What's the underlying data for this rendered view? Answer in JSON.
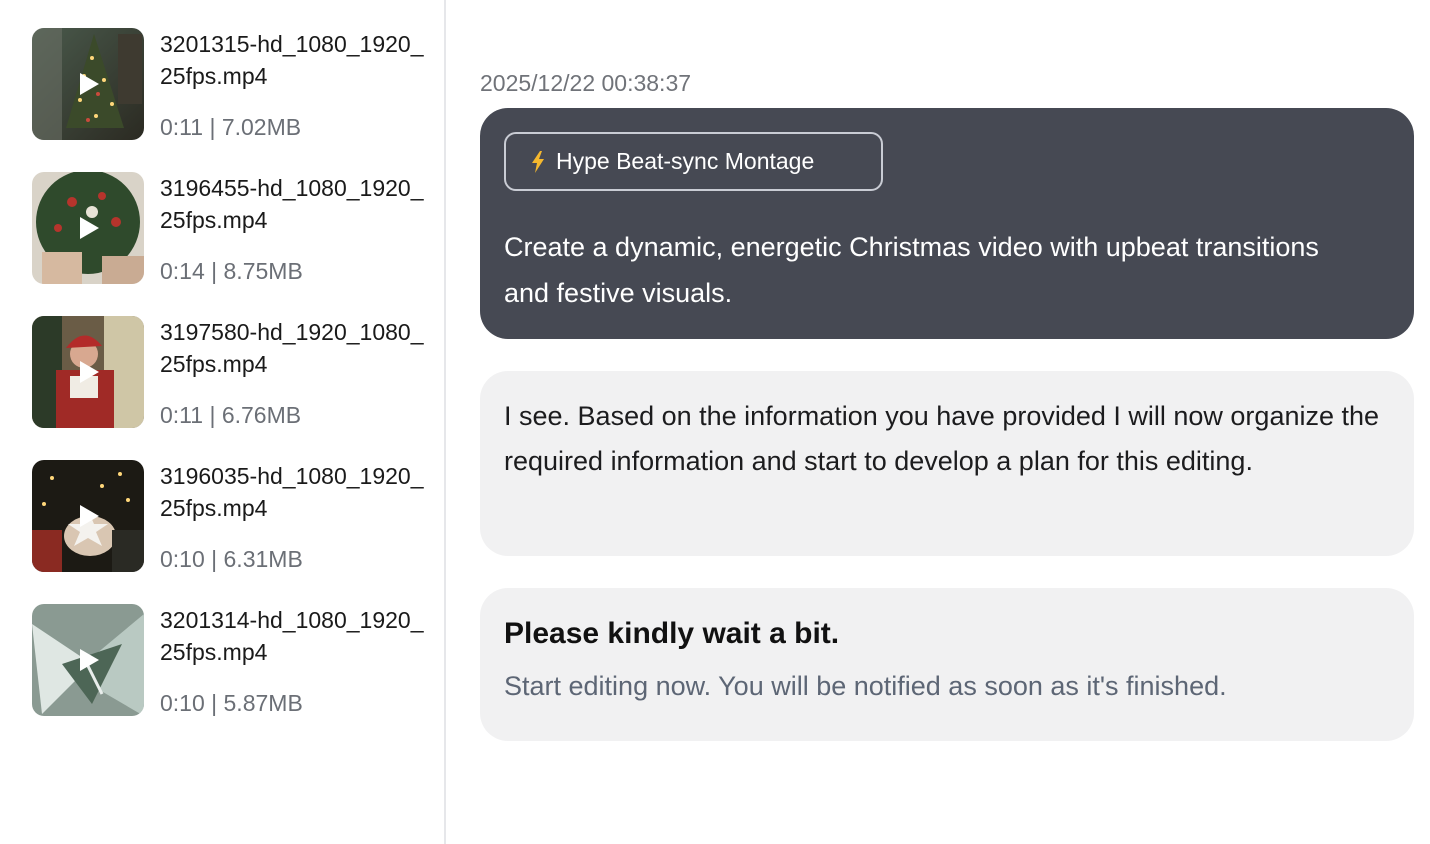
{
  "files": [
    {
      "name": "3201315-hd_1080_1920_25fps.mp4",
      "meta": "0:11 | 7.02MB",
      "thumb_icon": "play-icon"
    },
    {
      "name": "3196455-hd_1080_1920_25fps.mp4",
      "meta": "0:14 | 8.75MB",
      "thumb_icon": "play-icon"
    },
    {
      "name": "3197580-hd_1920_1080_25fps.mp4",
      "meta": "0:11 | 6.76MB",
      "thumb_icon": "play-icon"
    },
    {
      "name": "3196035-hd_1080_1920_25fps.mp4",
      "meta": "0:10 | 6.31MB",
      "thumb_icon": "play-icon"
    },
    {
      "name": "3201314-hd_1080_1920_25fps.mp4",
      "meta": "0:10 | 5.87MB",
      "thumb_icon": "play-icon"
    }
  ],
  "chat": {
    "timestamp": "2025/12/22 00:38:37",
    "user_message": {
      "template_label": "Hype Beat-sync Montage",
      "template_icon": "lightning-icon",
      "text": "Create a dynamic, energetic Christmas video with upbeat transitions and festive visuals."
    },
    "assistant_messages": [
      {
        "text": "I see. Based on the information you have provided I will now organize the required information and start to develop a plan for this editing."
      },
      {
        "title": "Please kindly wait a bit.",
        "subtitle": "Start editing now. You will be notified as soon as it's finished."
      }
    ]
  },
  "colors": {
    "user_bubble": "#464953",
    "assistant_bubble": "#f1f1f2",
    "lightning": "#f5b82e"
  }
}
